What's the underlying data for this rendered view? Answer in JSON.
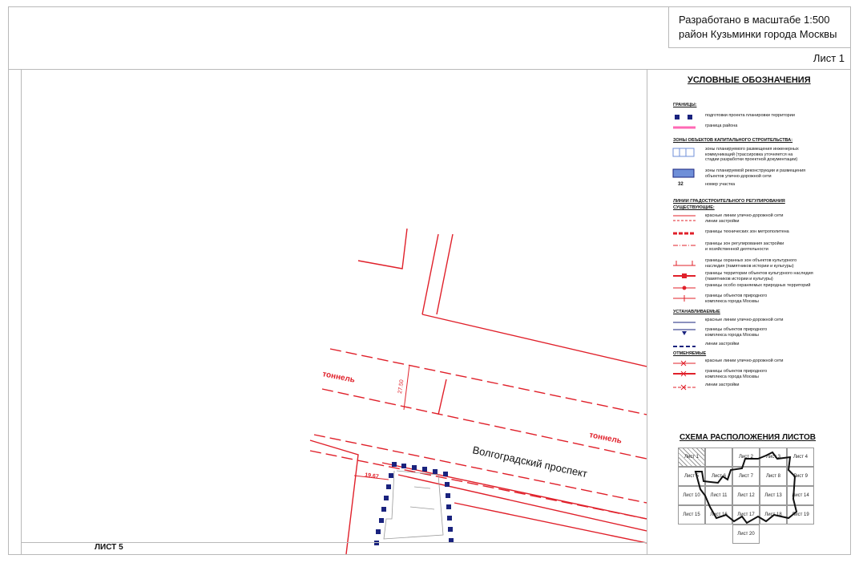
{
  "header": {
    "title_line1": "Разработано в масштабе 1:500",
    "title_line2": "район Кузьминки города Москвы",
    "sheet": "Лист 1"
  },
  "footer": {
    "sheet_ref": "ЛИСТ 5"
  },
  "map": {
    "street_name": "Волгоградский проспект",
    "tunnel_label_1": "тоннель",
    "tunnel_label_2": "тоннель",
    "dim_1": "27.50",
    "dim_2": "19.67"
  },
  "legend": {
    "title": "УСЛОВНЫЕ ОБОЗНАЧЕНИЯ",
    "sections": {
      "boundaries": "ГРАНИЦЫ:",
      "zones": "ЗОНЫ ОБЪЕКТОВ КАПИТАЛЬНОГО СТРОИТЕЛЬСТВА:",
      "lines": "ЛИНИИ ГРАДОСТРОИТЕЛЬНОГО РЕГУЛИРОВАНИЯ",
      "existing": "СУЩЕСТВУЮЩИЕ:",
      "established": "УСТАНАВЛИВАЕМЫЕ",
      "cancelled": "ОТМЕНЯЕМЫЕ"
    },
    "items": [
      "подготовки проекта планировки территории",
      "граница района",
      "зоны планируемого размещения инженерных\nкоммуникаций (трассировка уточняется на\nстадии разработки проектной документации)",
      "зоны планируемой реконструкции и размещения\nобъектов улично-дорожной сети",
      "номер участка",
      "красные линии улично-дорожной сети\nлинии застройки",
      "границы технических зон метрополитена",
      "границы зон регулирования застройки\nи хозяйственной деятельности",
      "границы охранных зон объектов культурного\nнаследия (памятников истории и культуры)",
      "границы территории объектов культурного наследия\n(памятников истории и культуры)",
      "границы особо охраняемых природных территорий",
      "границы объектов природного\nкомплекса города Москвы",
      "красные линии улично-дорожной сети",
      "границы объектов природного\nкомплекса города Москвы",
      "линии застройки",
      "красные линии улично-дорожной сети",
      "границы объектов природного\nкомплекса города Москвы",
      "линии застройки"
    ],
    "parcel_number": "32"
  },
  "scheme": {
    "title": "СХЕМА РАСПОЛОЖЕНИЯ ЛИСТОВ",
    "cells": [
      "Лист 1",
      "Лист 2",
      "Лист 3",
      "Лист 4",
      "Лист 5",
      "Лист 6",
      "Лист 7",
      "Лист 8",
      "Лист 9",
      "Лист 10",
      "Лист 11",
      "Лист 12",
      "Лист 13",
      "Лист 14",
      "Лист 15",
      "Лист 16",
      "Лист 17",
      "Лист 18",
      "Лист 19",
      "Лист 20"
    ]
  },
  "colors": {
    "red": "#e0202a",
    "navy": "#1a237e",
    "pink": "#ff69b4",
    "blue_fill": "#6f8fd8"
  }
}
